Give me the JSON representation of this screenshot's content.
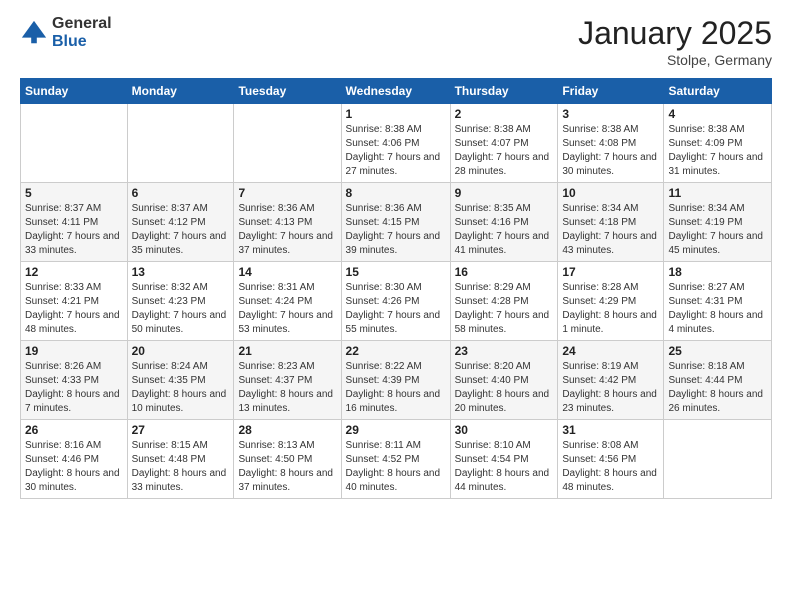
{
  "logo": {
    "general": "General",
    "blue": "Blue"
  },
  "title": "January 2025",
  "location": "Stolpe, Germany",
  "days_header": [
    "Sunday",
    "Monday",
    "Tuesday",
    "Wednesday",
    "Thursday",
    "Friday",
    "Saturday"
  ],
  "weeks": [
    [
      {
        "day": "",
        "info": ""
      },
      {
        "day": "",
        "info": ""
      },
      {
        "day": "",
        "info": ""
      },
      {
        "day": "1",
        "info": "Sunrise: 8:38 AM\nSunset: 4:06 PM\nDaylight: 7 hours and 27 minutes."
      },
      {
        "day": "2",
        "info": "Sunrise: 8:38 AM\nSunset: 4:07 PM\nDaylight: 7 hours and 28 minutes."
      },
      {
        "day": "3",
        "info": "Sunrise: 8:38 AM\nSunset: 4:08 PM\nDaylight: 7 hours and 30 minutes."
      },
      {
        "day": "4",
        "info": "Sunrise: 8:38 AM\nSunset: 4:09 PM\nDaylight: 7 hours and 31 minutes."
      }
    ],
    [
      {
        "day": "5",
        "info": "Sunrise: 8:37 AM\nSunset: 4:11 PM\nDaylight: 7 hours and 33 minutes."
      },
      {
        "day": "6",
        "info": "Sunrise: 8:37 AM\nSunset: 4:12 PM\nDaylight: 7 hours and 35 minutes."
      },
      {
        "day": "7",
        "info": "Sunrise: 8:36 AM\nSunset: 4:13 PM\nDaylight: 7 hours and 37 minutes."
      },
      {
        "day": "8",
        "info": "Sunrise: 8:36 AM\nSunset: 4:15 PM\nDaylight: 7 hours and 39 minutes."
      },
      {
        "day": "9",
        "info": "Sunrise: 8:35 AM\nSunset: 4:16 PM\nDaylight: 7 hours and 41 minutes."
      },
      {
        "day": "10",
        "info": "Sunrise: 8:34 AM\nSunset: 4:18 PM\nDaylight: 7 hours and 43 minutes."
      },
      {
        "day": "11",
        "info": "Sunrise: 8:34 AM\nSunset: 4:19 PM\nDaylight: 7 hours and 45 minutes."
      }
    ],
    [
      {
        "day": "12",
        "info": "Sunrise: 8:33 AM\nSunset: 4:21 PM\nDaylight: 7 hours and 48 minutes."
      },
      {
        "day": "13",
        "info": "Sunrise: 8:32 AM\nSunset: 4:23 PM\nDaylight: 7 hours and 50 minutes."
      },
      {
        "day": "14",
        "info": "Sunrise: 8:31 AM\nSunset: 4:24 PM\nDaylight: 7 hours and 53 minutes."
      },
      {
        "day": "15",
        "info": "Sunrise: 8:30 AM\nSunset: 4:26 PM\nDaylight: 7 hours and 55 minutes."
      },
      {
        "day": "16",
        "info": "Sunrise: 8:29 AM\nSunset: 4:28 PM\nDaylight: 7 hours and 58 minutes."
      },
      {
        "day": "17",
        "info": "Sunrise: 8:28 AM\nSunset: 4:29 PM\nDaylight: 8 hours and 1 minute."
      },
      {
        "day": "18",
        "info": "Sunrise: 8:27 AM\nSunset: 4:31 PM\nDaylight: 8 hours and 4 minutes."
      }
    ],
    [
      {
        "day": "19",
        "info": "Sunrise: 8:26 AM\nSunset: 4:33 PM\nDaylight: 8 hours and 7 minutes."
      },
      {
        "day": "20",
        "info": "Sunrise: 8:24 AM\nSunset: 4:35 PM\nDaylight: 8 hours and 10 minutes."
      },
      {
        "day": "21",
        "info": "Sunrise: 8:23 AM\nSunset: 4:37 PM\nDaylight: 8 hours and 13 minutes."
      },
      {
        "day": "22",
        "info": "Sunrise: 8:22 AM\nSunset: 4:39 PM\nDaylight: 8 hours and 16 minutes."
      },
      {
        "day": "23",
        "info": "Sunrise: 8:20 AM\nSunset: 4:40 PM\nDaylight: 8 hours and 20 minutes."
      },
      {
        "day": "24",
        "info": "Sunrise: 8:19 AM\nSunset: 4:42 PM\nDaylight: 8 hours and 23 minutes."
      },
      {
        "day": "25",
        "info": "Sunrise: 8:18 AM\nSunset: 4:44 PM\nDaylight: 8 hours and 26 minutes."
      }
    ],
    [
      {
        "day": "26",
        "info": "Sunrise: 8:16 AM\nSunset: 4:46 PM\nDaylight: 8 hours and 30 minutes."
      },
      {
        "day": "27",
        "info": "Sunrise: 8:15 AM\nSunset: 4:48 PM\nDaylight: 8 hours and 33 minutes."
      },
      {
        "day": "28",
        "info": "Sunrise: 8:13 AM\nSunset: 4:50 PM\nDaylight: 8 hours and 37 minutes."
      },
      {
        "day": "29",
        "info": "Sunrise: 8:11 AM\nSunset: 4:52 PM\nDaylight: 8 hours and 40 minutes."
      },
      {
        "day": "30",
        "info": "Sunrise: 8:10 AM\nSunset: 4:54 PM\nDaylight: 8 hours and 44 minutes."
      },
      {
        "day": "31",
        "info": "Sunrise: 8:08 AM\nSunset: 4:56 PM\nDaylight: 8 hours and 48 minutes."
      },
      {
        "day": "",
        "info": ""
      }
    ]
  ]
}
